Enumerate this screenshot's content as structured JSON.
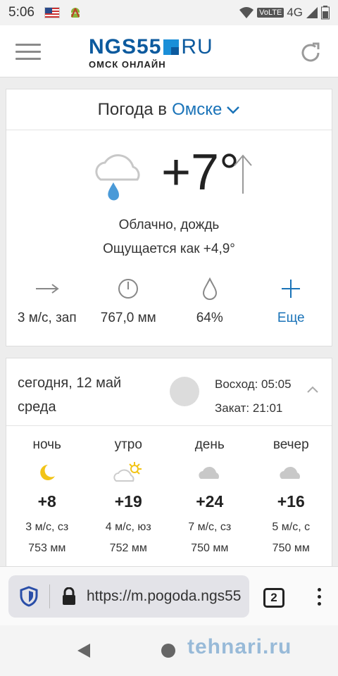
{
  "status_bar": {
    "time": "5:06",
    "network": "4G",
    "volte": "VoLTE"
  },
  "header": {
    "logo_text": "NGS55",
    "logo_domain": "RU",
    "logo_sub": "ОМСК ОНЛАЙН"
  },
  "weather": {
    "title_prefix": "Погода в",
    "city": "Омске",
    "temperature": "+7°",
    "condition": "Облачно, дождь",
    "feels_like": "Ощущается как +4,9°",
    "wind": "3 м/с, зап",
    "pressure": "767,0 мм",
    "humidity": "64%",
    "more_label": "Еще"
  },
  "forecast": {
    "date_line1": "сегодня, 12 май",
    "date_line2": "среда",
    "sunrise": "Восход: 05:05",
    "sunset": "Закат: 21:01",
    "parts": [
      {
        "name": "ночь",
        "temp": "+8",
        "wind": "3 м/с, сз",
        "pressure": "753 мм",
        "icon": "moon-icon"
      },
      {
        "name": "утро",
        "temp": "+19",
        "wind": "4 м/с, юз",
        "pressure": "752 мм",
        "icon": "sun-cloud-icon"
      },
      {
        "name": "день",
        "temp": "+24",
        "wind": "7 м/с, сз",
        "pressure": "750 мм",
        "icon": "cloud-icon"
      },
      {
        "name": "вечер",
        "temp": "+16",
        "wind": "5 м/с, с",
        "pressure": "750 мм",
        "icon": "cloud-icon"
      }
    ]
  },
  "browser": {
    "url": "https://m.pogoda.ngs55",
    "tab_count": "2"
  },
  "watermark": "tehnari.ru",
  "colors": {
    "accent": "#1a73b8",
    "logo_blue": "#0c5a9e",
    "rain_drop": "#4a9ad8",
    "sun_yellow": "#f2c417"
  }
}
